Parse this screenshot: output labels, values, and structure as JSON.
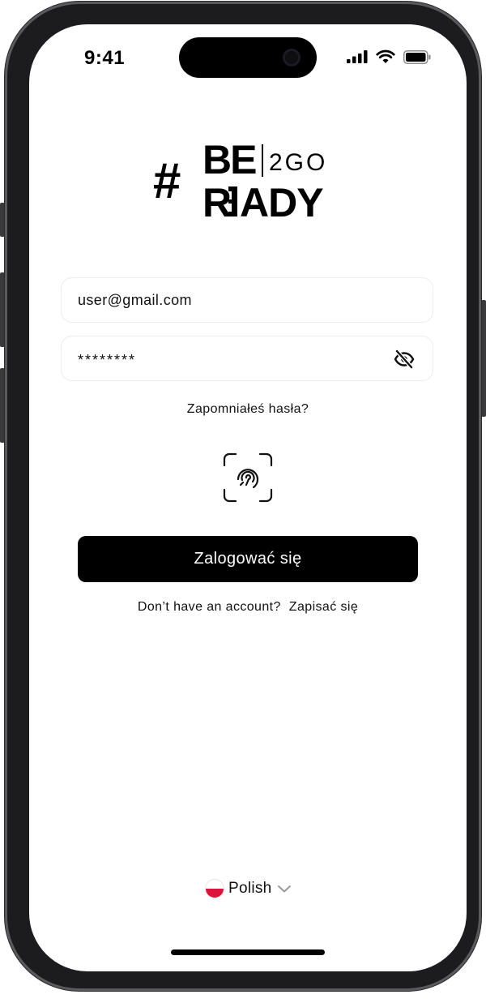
{
  "status_bar": {
    "time": "9:41",
    "icons": [
      "cellular-signal-icon",
      "wifi-icon",
      "battery-icon"
    ]
  },
  "logo": {
    "hash": "#",
    "line1": "BE",
    "suffix": "2GO",
    "line2_first": "R",
    "line2_rest": "ADY"
  },
  "form": {
    "email_value": "user@gmail.com",
    "password_value": "********",
    "forgot_label": "Zapomniałeś hasła?",
    "login_label": "Zalogować się",
    "faceid_icon": "face-id-icon",
    "eye_icon": "eye-slash-icon"
  },
  "signup": {
    "prompt": "Don’t have an account?",
    "link": "Zapisać się"
  },
  "language": {
    "label": "Polish",
    "flag_icon": "poland-flag-icon",
    "chevron_icon": "chevron-down-icon"
  },
  "colors": {
    "primary": "#000000",
    "background": "#ffffff",
    "field_border": "#ececec",
    "flag_red": "#dc143c"
  }
}
